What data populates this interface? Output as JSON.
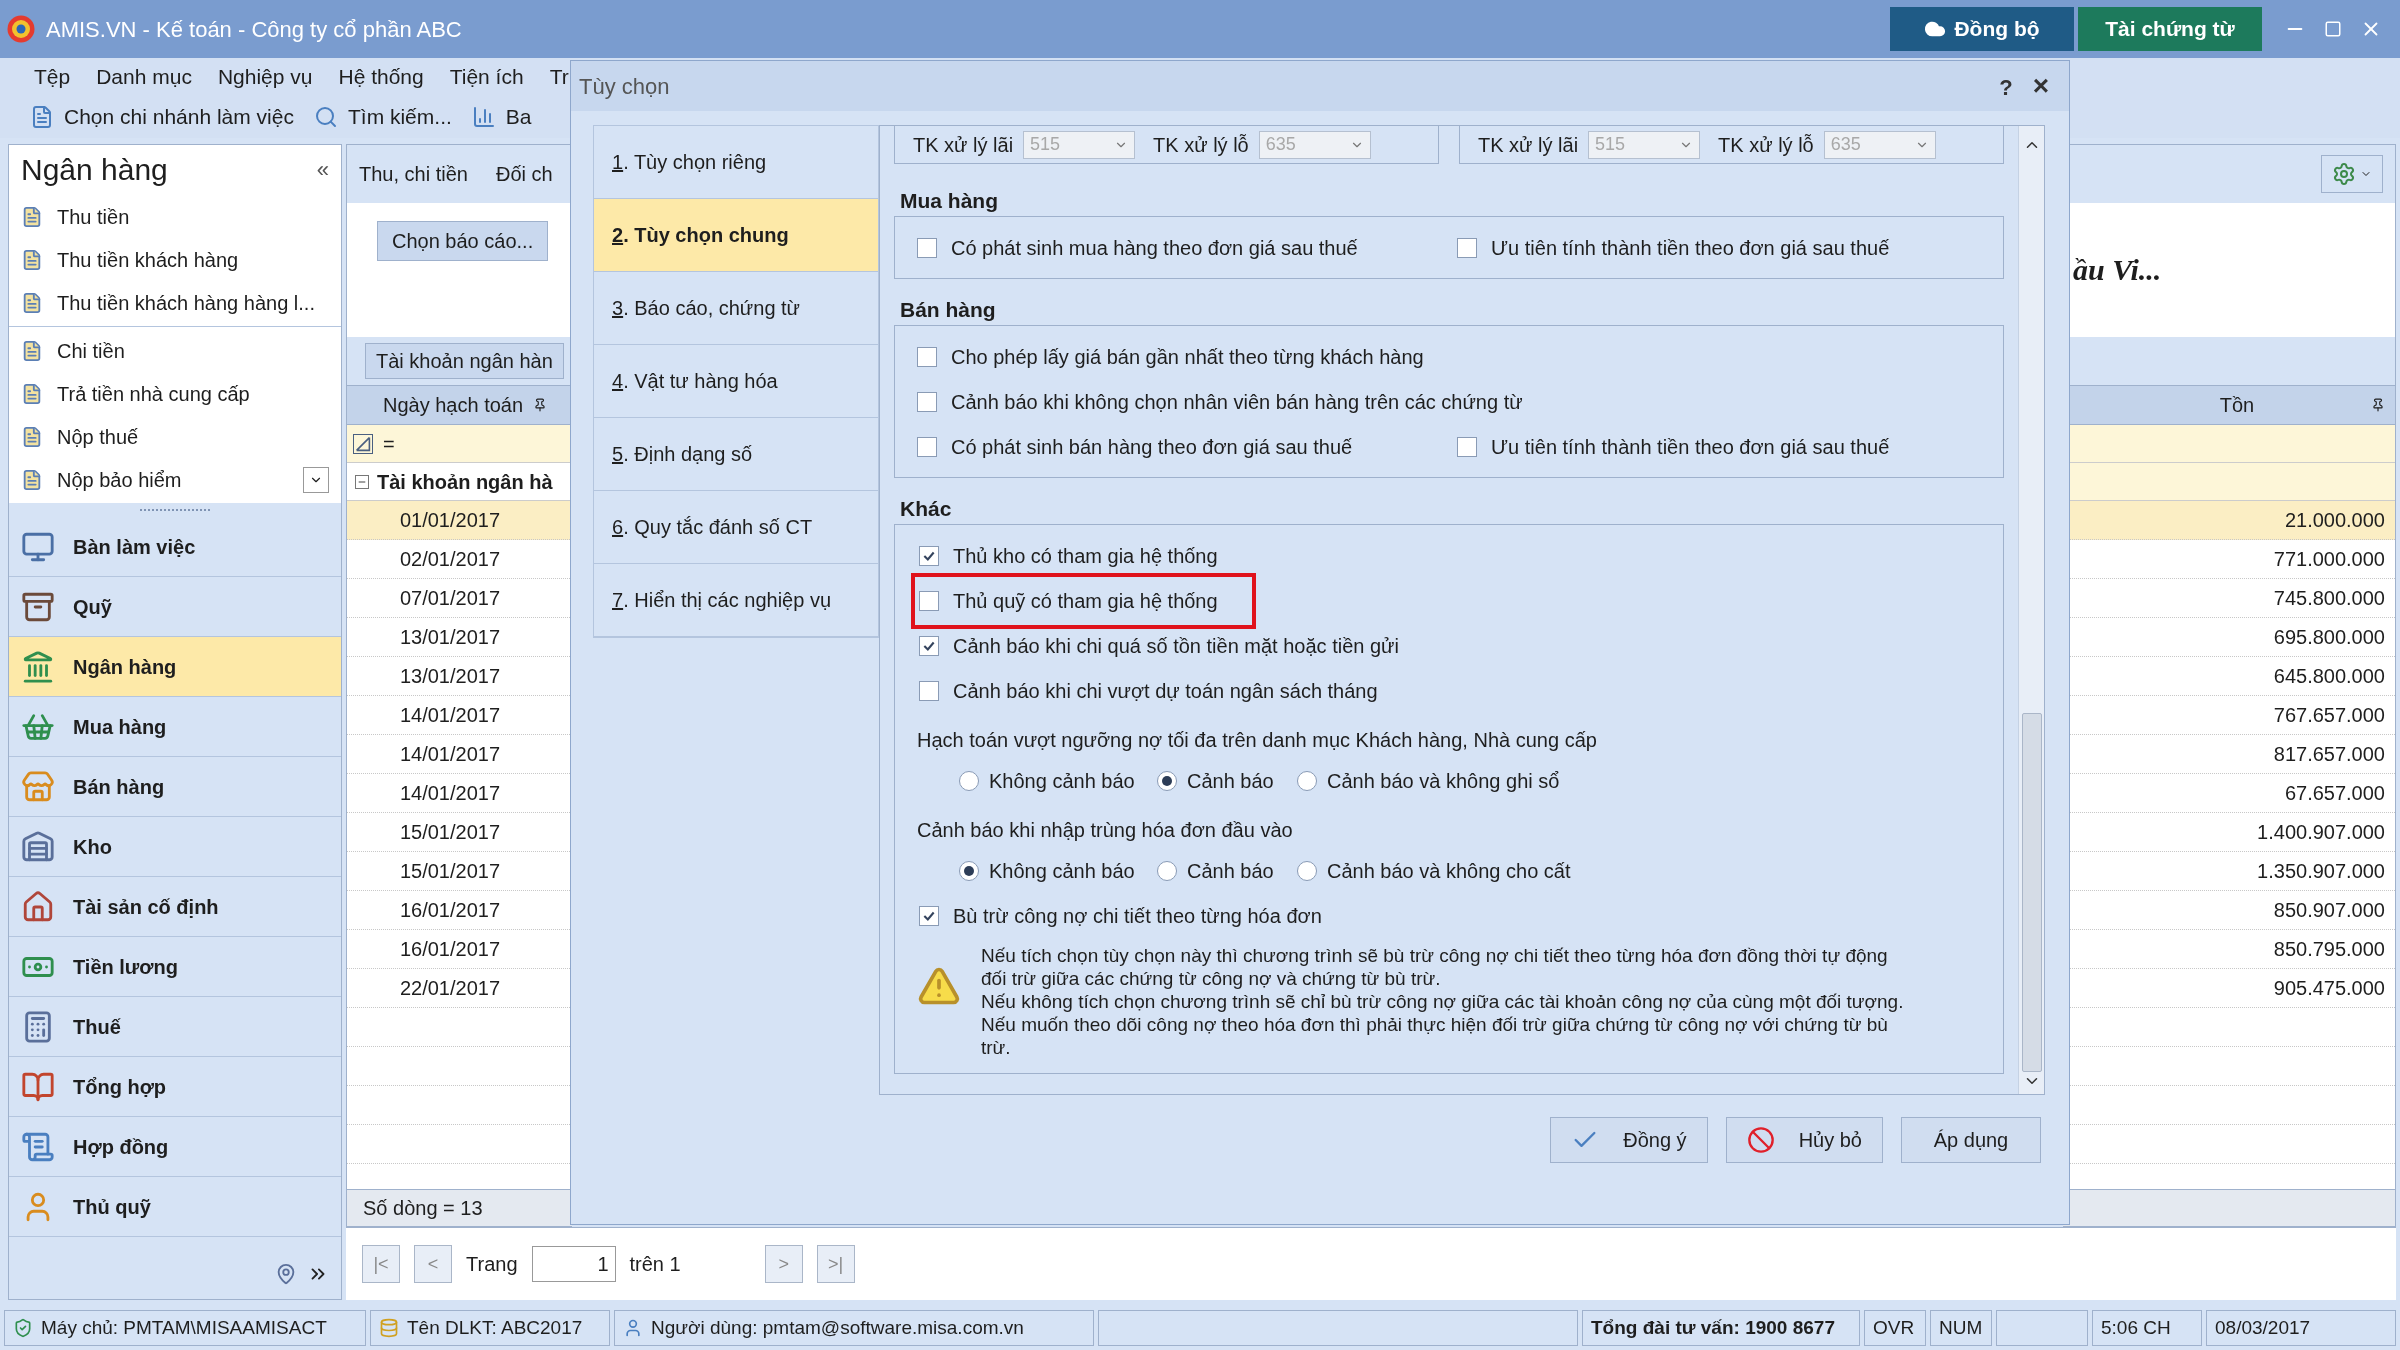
{
  "window": {
    "title": "AMIS.VN - Kế toán - Công ty cổ phần ABC",
    "buttons": [
      {
        "label": "Đồng bộ",
        "kind": "sync"
      },
      {
        "label": "Tài chứng từ",
        "kind": "download"
      }
    ]
  },
  "menu": [
    "Tệp",
    "Danh mục",
    "Nghiệp vụ",
    "Hệ thống",
    "Tiện ích",
    "Tr"
  ],
  "toolbar": [
    {
      "label": "Chọn chi nhánh làm việc",
      "kind": "branch"
    },
    {
      "label": "Tìm kiếm...",
      "kind": "search"
    },
    {
      "label": "Ba",
      "kind": "report"
    }
  ],
  "sidebar": {
    "title": "Ngân hàng",
    "collapse": "«",
    "task_groups": [
      [
        "Thu tiền",
        "Thu tiền khách hàng",
        "Thu tiền khách hàng hàng l..."
      ],
      [
        "Chi tiền",
        "Trả tiền nhà cung cấp",
        "Nộp thuế",
        "Nộp bảo hiểm"
      ]
    ],
    "modules": [
      {
        "label": "Bàn làm việc",
        "kind": "desk",
        "selected": false
      },
      {
        "label": "Quỹ",
        "kind": "cash",
        "selected": false
      },
      {
        "label": "Ngân hàng",
        "kind": "bank",
        "selected": true
      },
      {
        "label": "Mua hàng",
        "kind": "purchase",
        "selected": false
      },
      {
        "label": "Bán hàng",
        "kind": "sales",
        "selected": false
      },
      {
        "label": "Kho",
        "kind": "stock",
        "selected": false
      },
      {
        "label": "Tài sản cố định",
        "kind": "asset",
        "selected": false
      },
      {
        "label": "Tiền lương",
        "kind": "salary",
        "selected": false
      },
      {
        "label": "Thuế",
        "kind": "tax",
        "selected": false
      },
      {
        "label": "Tổng hợp",
        "kind": "general",
        "selected": false
      },
      {
        "label": "Hợp đồng",
        "kind": "contract",
        "selected": false
      },
      {
        "label": "Thủ quỹ",
        "kind": "cashier",
        "selected": false
      }
    ]
  },
  "content": {
    "tabs": [
      "Thu, chi tiền",
      "Đối ch"
    ],
    "report_button": "Chọn báo cáo...",
    "report_title": "ầu Vi...",
    "account_button": "Tài khoản ngân hàn",
    "columns": [
      "Ngày hạch toán",
      "Tồn"
    ],
    "filter_operator": "=",
    "group_label": "Tài khoản ngân hà",
    "rows": [
      {
        "date": "01/01/2017",
        "balance": "21.000.000",
        "selected": true
      },
      {
        "date": "02/01/2017",
        "balance": "771.000.000",
        "selected": false
      },
      {
        "date": "07/01/2017",
        "balance": "745.800.000",
        "selected": false
      },
      {
        "date": "13/01/2017",
        "balance": "695.800.000",
        "selected": false
      },
      {
        "date": "13/01/2017",
        "balance": "645.800.000",
        "selected": false
      },
      {
        "date": "14/01/2017",
        "balance": "767.657.000",
        "selected": false
      },
      {
        "date": "14/01/2017",
        "balance": "817.657.000",
        "selected": false
      },
      {
        "date": "14/01/2017",
        "balance": "67.657.000",
        "selected": false
      },
      {
        "date": "15/01/2017",
        "balance": "1.400.907.000",
        "selected": false
      },
      {
        "date": "15/01/2017",
        "balance": "1.350.907.000",
        "selected": false
      },
      {
        "date": "16/01/2017",
        "balance": "850.907.000",
        "selected": false
      },
      {
        "date": "16/01/2017",
        "balance": "850.795.000",
        "selected": false
      },
      {
        "date": "22/01/2017",
        "balance": "905.475.000",
        "selected": false
      }
    ],
    "row_count": "Số dòng = 13"
  },
  "pager": {
    "first": "|<",
    "prev": "<",
    "label": "Trang",
    "page": "1",
    "total": "trên 1",
    "next": ">",
    "last": ">|"
  },
  "status_bar": [
    {
      "text": "Máy chủ: PMTAM\\MISAAMISACT",
      "kind": "server"
    },
    {
      "text": "Tên DLKT: ABC2017",
      "kind": "database"
    },
    {
      "text": "Người dùng: pmtam@software.misa.com.vn",
      "kind": "user"
    },
    {
      "text": "Tổng đài tư vấn: 1900 8677",
      "kind": "hotline"
    },
    {
      "text": "OVR",
      "kind": "ovr"
    },
    {
      "text": "NUM",
      "kind": "num"
    },
    {
      "text": "5:06 CH",
      "kind": "time"
    },
    {
      "text": "08/03/2017",
      "kind": "date"
    }
  ],
  "dialog": {
    "title": "Tùy chọn",
    "help": "?",
    "close": "×",
    "nav": [
      {
        "label": "1. Tùy chọn riêng",
        "selected": false
      },
      {
        "label": "2. Tùy chọn chung",
        "selected": true
      },
      {
        "label": "3. Báo cáo, chứng từ",
        "selected": false
      },
      {
        "label": "4. Vật tư hàng hóa",
        "selected": false
      },
      {
        "label": "5. Định dạng số",
        "selected": false
      },
      {
        "label": "6. Quy tắc đánh số CT",
        "selected": false
      },
      {
        "label": "7. Hiển thị các nghiệp vụ",
        "selected": false
      }
    ],
    "account_boxes": [
      [
        {
          "label": "TK xử lý lãi",
          "value": "515"
        },
        {
          "label": "TK xử lý lỗ",
          "value": "635"
        }
      ],
      [
        {
          "label": "TK xử lý lãi",
          "value": "515"
        },
        {
          "label": "TK xử lý lỗ",
          "value": "635"
        }
      ]
    ],
    "groups": [
      {
        "title": "Mua hàng",
        "rows": [
          [
            {
              "label": "Có phát sinh mua hàng theo đơn giá sau thuế",
              "checked": false
            },
            {
              "label": "Ưu tiên tính thành tiền theo đơn giá sau thuế",
              "checked": false
            }
          ]
        ]
      },
      {
        "title": "Bán hàng",
        "rows": [
          [
            {
              "label": "Cho phép lấy giá bán gần nhất theo từng khách hàng",
              "checked": false
            }
          ],
          [
            {
              "label": "Cảnh báo khi không chọn nhân viên bán hàng trên các chứng từ",
              "checked": false
            }
          ],
          [
            {
              "label": "Có phát sinh bán hàng theo đơn giá sau thuế",
              "checked": false
            },
            {
              "label": "Ưu tiên tính thành tiền theo đơn giá sau thuế",
              "checked": false
            }
          ]
        ]
      }
    ],
    "other": {
      "title": "Khác",
      "items": [
        {
          "kind": "checkbox",
          "label": "Thủ kho có tham gia hệ thống",
          "checked": true,
          "highlighted": false
        },
        {
          "kind": "checkbox",
          "label": "Thủ quỹ có tham gia hệ thống",
          "checked": false,
          "highlighted": true
        },
        {
          "kind": "checkbox",
          "label": "Cảnh báo khi chi quá số tồn tiền mặt hoặc tiền gửi",
          "checked": true,
          "highlighted": false
        },
        {
          "kind": "checkbox",
          "label": "Cảnh báo khi chi vượt dự toán ngân sách tháng",
          "checked": false,
          "highlighted": false
        },
        {
          "kind": "heading",
          "label": "Hạch toán vượt ngưỡng nợ tối đa trên danh mục Khách hàng, Nhà cung cấp"
        },
        {
          "kind": "radios",
          "options": [
            {
              "label": "Không cảnh báo",
              "selected": false
            },
            {
              "label": "Cảnh báo",
              "selected": true
            },
            {
              "label": "Cảnh báo và không ghi sổ",
              "selected": false
            }
          ]
        },
        {
          "kind": "heading",
          "label": "Cảnh báo khi nhập trùng hóa đơn đầu vào"
        },
        {
          "kind": "radios",
          "options": [
            {
              "label": "Không cảnh báo",
              "selected": true
            },
            {
              "label": "Cảnh báo",
              "selected": false
            },
            {
              "label": "Cảnh báo và không cho cất",
              "selected": false
            }
          ]
        },
        {
          "kind": "checkbox",
          "label": "Bù trừ công nợ chi tiết theo từng hóa đơn",
          "checked": true,
          "highlighted": false
        },
        {
          "kind": "note",
          "paragraphs": [
            "Nếu tích chọn tùy chọn này thì chương trình sẽ bù trừ công nợ chi tiết theo từng hóa đơn đồng thời tự động đối trừ giữa các chứng từ công nợ và chứng từ bù trừ.",
            "Nếu không tích chọn chương trình sẽ chỉ bù trừ công nợ giữa các tài khoản công nợ của cùng một đối tượng. Nếu muốn theo dõi công nợ theo hóa đơn thì phải thực hiện đối trừ giữa chứng từ công nợ với chứng từ bù trừ."
          ]
        }
      ]
    },
    "buttons": [
      {
        "label": "Đồng ý",
        "kind": "ok"
      },
      {
        "label": "Hủy bỏ",
        "kind": "cancel"
      },
      {
        "label": "Áp dụng",
        "kind": "apply"
      }
    ]
  }
}
